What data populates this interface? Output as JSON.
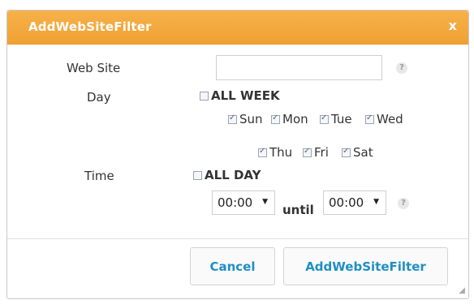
{
  "dialog": {
    "title": "AddWebSiteFilter",
    "close_label": "x",
    "web_site_label": "Web Site",
    "web_site_value": "",
    "help_mark": "?",
    "day_label": "Day",
    "all_week_label": "ALL WEEK",
    "all_week_checked": false,
    "days": [
      {
        "label": "Sun",
        "checked": true
      },
      {
        "label": "Mon",
        "checked": true
      },
      {
        "label": "Tue",
        "checked": true
      },
      {
        "label": "Wed",
        "checked": true
      },
      {
        "label": "Thu",
        "checked": true
      },
      {
        "label": "Fri",
        "checked": true
      },
      {
        "label": "Sat",
        "checked": true
      }
    ],
    "time_label": "Time",
    "all_day_label": "ALL DAY",
    "all_day_checked": false,
    "from_time": "00:00",
    "until_label": "until",
    "to_time": "00:00",
    "cancel_label": "Cancel",
    "submit_label": "AddWebSiteFilter",
    "accent_color": "#f2a53b",
    "button_text_color": "#1f8fc4"
  }
}
